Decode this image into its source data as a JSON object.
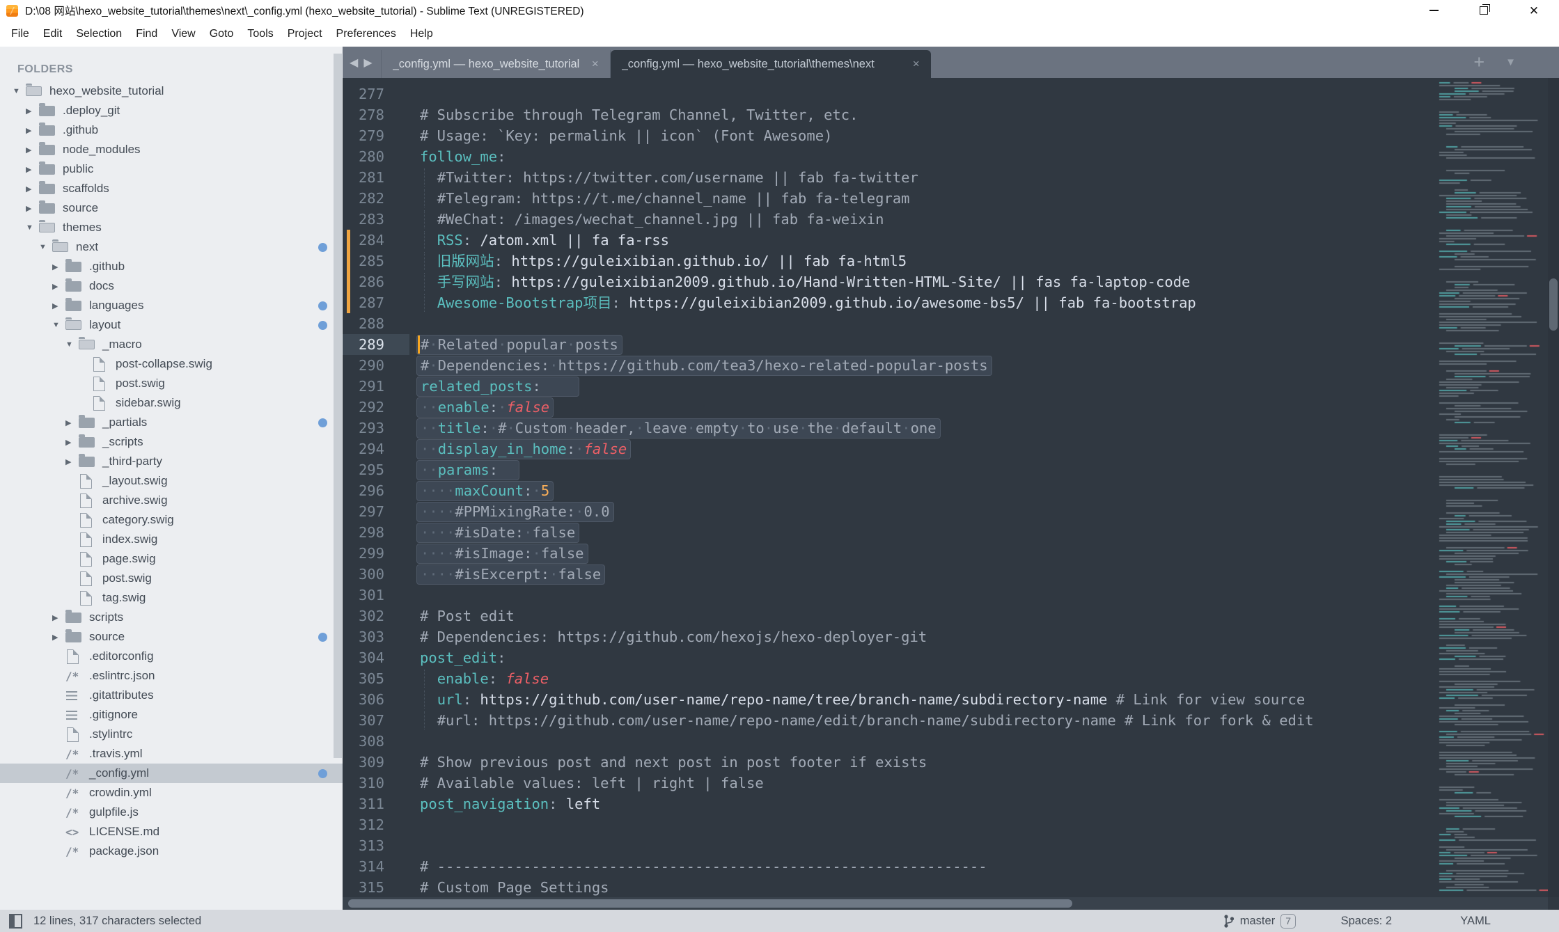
{
  "window": {
    "title": "D:\\08 网站\\hexo_website_tutorial\\themes\\next\\_config.yml (hexo_website_tutorial) - Sublime Text (UNREGISTERED)"
  },
  "menu": [
    "File",
    "Edit",
    "Selection",
    "Find",
    "View",
    "Goto",
    "Tools",
    "Project",
    "Preferences",
    "Help"
  ],
  "sidebar": {
    "header": "FOLDERS",
    "items": [
      {
        "label": "hexo_website_tutorial",
        "icon": "folder-open",
        "arrow": "down",
        "level": 0
      },
      {
        "label": ".deploy_git",
        "icon": "folder",
        "arrow": "right",
        "level": 1
      },
      {
        "label": ".github",
        "icon": "folder",
        "arrow": "right",
        "level": 1
      },
      {
        "label": "node_modules",
        "icon": "folder",
        "arrow": "right",
        "level": 1
      },
      {
        "label": "public",
        "icon": "folder",
        "arrow": "right",
        "level": 1
      },
      {
        "label": "scaffolds",
        "icon": "folder",
        "arrow": "right",
        "level": 1
      },
      {
        "label": "source",
        "icon": "folder",
        "arrow": "right",
        "level": 1
      },
      {
        "label": "themes",
        "icon": "folder-open",
        "arrow": "down",
        "level": 1
      },
      {
        "label": "next",
        "icon": "folder-open",
        "arrow": "down",
        "level": 2,
        "dot": true
      },
      {
        "label": ".github",
        "icon": "folder",
        "arrow": "right",
        "level": 3
      },
      {
        "label": "docs",
        "icon": "folder",
        "arrow": "right",
        "level": 3
      },
      {
        "label": "languages",
        "icon": "folder",
        "arrow": "right",
        "level": 3,
        "dot": true
      },
      {
        "label": "layout",
        "icon": "folder-open",
        "arrow": "down",
        "level": 3,
        "dot": true
      },
      {
        "label": "_macro",
        "icon": "folder-open",
        "arrow": "down",
        "level": 4
      },
      {
        "label": "post-collapse.swig",
        "icon": "file",
        "level": 5
      },
      {
        "label": "post.swig",
        "icon": "file",
        "level": 5
      },
      {
        "label": "sidebar.swig",
        "icon": "file",
        "level": 5
      },
      {
        "label": "_partials",
        "icon": "folder",
        "arrow": "right",
        "level": 4,
        "dot": true
      },
      {
        "label": "_scripts",
        "icon": "folder",
        "arrow": "right",
        "level": 4
      },
      {
        "label": "_third-party",
        "icon": "folder",
        "arrow": "right",
        "level": 4
      },
      {
        "label": "_layout.swig",
        "icon": "file",
        "level": 4
      },
      {
        "label": "archive.swig",
        "icon": "file",
        "level": 4
      },
      {
        "label": "category.swig",
        "icon": "file",
        "level": 4
      },
      {
        "label": "index.swig",
        "icon": "file",
        "level": 4
      },
      {
        "label": "page.swig",
        "icon": "file",
        "level": 4
      },
      {
        "label": "post.swig",
        "icon": "file",
        "level": 4
      },
      {
        "label": "tag.swig",
        "icon": "file",
        "level": 4
      },
      {
        "label": "scripts",
        "icon": "folder",
        "arrow": "right",
        "level": 3
      },
      {
        "label": "source",
        "icon": "folder",
        "arrow": "right",
        "level": 3,
        "dot": true
      },
      {
        "label": ".editorconfig",
        "icon": "file",
        "level": 3
      },
      {
        "label": ".eslintrc.json",
        "icon": "slash-star",
        "level": 3
      },
      {
        "label": ".gitattributes",
        "icon": "list",
        "level": 3
      },
      {
        "label": ".gitignore",
        "icon": "list",
        "level": 3
      },
      {
        "label": ".stylintrc",
        "icon": "file",
        "level": 3
      },
      {
        "label": ".travis.yml",
        "icon": "slash-star",
        "level": 3
      },
      {
        "label": "_config.yml",
        "icon": "slash-star",
        "level": 3,
        "dot": true,
        "selected": true
      },
      {
        "label": "crowdin.yml",
        "icon": "slash-star",
        "level": 3
      },
      {
        "label": "gulpfile.js",
        "icon": "slash-star",
        "level": 3
      },
      {
        "label": "LICENSE.md",
        "icon": "angle",
        "level": 3
      },
      {
        "label": "package.json",
        "icon": "slash-star",
        "level": 3
      }
    ]
  },
  "tabs": {
    "back_icon": "◀",
    "forward_icon": "▶",
    "items": [
      {
        "title": "_config.yml — hexo_website_tutorial",
        "active": false,
        "close": "×"
      },
      {
        "title": "_config.yml — hexo_website_tutorial\\themes\\next",
        "active": true,
        "close": "×"
      }
    ],
    "new_tab_icon": "+",
    "tab_list_icon": "▼"
  },
  "editor": {
    "lines": [
      {
        "n": 277,
        "tk": []
      },
      {
        "n": 278,
        "tk": [
          {
            "c": "com",
            "t": "# Subscribe through Telegram Channel, Twitter, etc."
          }
        ]
      },
      {
        "n": 279,
        "tk": [
          {
            "c": "com",
            "t": "# Usage: `Key: permalink || icon` (Font Awesome)"
          }
        ]
      },
      {
        "n": 280,
        "tk": [
          {
            "c": "key",
            "t": "follow_me"
          },
          {
            "c": "pun",
            "t": ":"
          }
        ]
      },
      {
        "n": 281,
        "guide": true,
        "tk": [
          {
            "c": "ws",
            "t": "  "
          },
          {
            "c": "com",
            "t": "#Twitter: https://twitter.com/username || fab fa-twitter"
          }
        ]
      },
      {
        "n": 282,
        "guide": true,
        "tk": [
          {
            "c": "ws",
            "t": "  "
          },
          {
            "c": "com",
            "t": "#Telegram: https://t.me/channel_name || fab fa-telegram"
          }
        ]
      },
      {
        "n": 283,
        "guide": true,
        "tk": [
          {
            "c": "ws",
            "t": "  "
          },
          {
            "c": "com",
            "t": "#WeChat: /images/wechat_channel.jpg || fab fa-weixin"
          }
        ]
      },
      {
        "n": 284,
        "guide": true,
        "mod": true,
        "tk": [
          {
            "c": "ws",
            "t": "  "
          },
          {
            "c": "key",
            "t": "RSS"
          },
          {
            "c": "pun",
            "t": ":"
          },
          {
            "c": "val",
            "t": " /atom.xml || fa fa-rss"
          }
        ]
      },
      {
        "n": 285,
        "guide": true,
        "mod": true,
        "tk": [
          {
            "c": "ws",
            "t": "  "
          },
          {
            "c": "key",
            "t": "旧版网站"
          },
          {
            "c": "pun",
            "t": ":"
          },
          {
            "c": "val",
            "t": " https://guleixibian.github.io/ || fab fa-html5"
          }
        ]
      },
      {
        "n": 286,
        "guide": true,
        "mod": true,
        "tk": [
          {
            "c": "ws",
            "t": "  "
          },
          {
            "c": "key",
            "t": "手写网站"
          },
          {
            "c": "pun",
            "t": ":"
          },
          {
            "c": "val",
            "t": " https://guleixibian2009.github.io/Hand-Written-HTML-Site/ || fas fa-laptop-code"
          }
        ]
      },
      {
        "n": 287,
        "guide": true,
        "mod": true,
        "tk": [
          {
            "c": "ws",
            "t": "  "
          },
          {
            "c": "key",
            "t": "Awesome-Bootstrap项目"
          },
          {
            "c": "pun",
            "t": ":"
          },
          {
            "c": "val",
            "t": " https://guleixibian2009.github.io/awesome-bs5/ || fab fa-bootstrap"
          }
        ]
      },
      {
        "n": 288,
        "tk": []
      },
      {
        "n": 289,
        "sel": true,
        "cur": true,
        "tk": [
          {
            "c": "com",
            "t": "# Related popular posts"
          }
        ]
      },
      {
        "n": 290,
        "sel": true,
        "tk": [
          {
            "c": "com",
            "t": "# Dependencies: https://github.com/tea3/hexo-related-popular-posts"
          }
        ]
      },
      {
        "n": 291,
        "sel": true,
        "tk": [
          {
            "c": "key",
            "t": "related_posts"
          },
          {
            "c": "pun",
            "t": ":"
          },
          {
            "c": "nl",
            "t": "    "
          }
        ]
      },
      {
        "n": 292,
        "sel": true,
        "tk": [
          {
            "c": "ws",
            "t": "  "
          },
          {
            "c": "key",
            "t": "enable"
          },
          {
            "c": "pun",
            "t": ":"
          },
          {
            "c": "ws",
            "t": " "
          },
          {
            "c": "fls",
            "t": "false"
          }
        ]
      },
      {
        "n": 293,
        "sel": true,
        "tk": [
          {
            "c": "ws",
            "t": "  "
          },
          {
            "c": "key",
            "t": "title"
          },
          {
            "c": "pun",
            "t": ":"
          },
          {
            "c": "ws",
            "t": " "
          },
          {
            "c": "com",
            "t": "# Custom header, leave empty to use the default one"
          }
        ]
      },
      {
        "n": 294,
        "sel": true,
        "tk": [
          {
            "c": "ws",
            "t": "  "
          },
          {
            "c": "key",
            "t": "display_in_home"
          },
          {
            "c": "pun",
            "t": ":"
          },
          {
            "c": "ws",
            "t": " "
          },
          {
            "c": "fls",
            "t": "false"
          }
        ]
      },
      {
        "n": 295,
        "sel": true,
        "tk": [
          {
            "c": "ws",
            "t": "  "
          },
          {
            "c": "key",
            "t": "params"
          },
          {
            "c": "pun",
            "t": ":"
          },
          {
            "c": "nl",
            "t": "  "
          }
        ]
      },
      {
        "n": 296,
        "sel": true,
        "tk": [
          {
            "c": "ws",
            "t": "    "
          },
          {
            "c": "key",
            "t": "maxCount"
          },
          {
            "c": "pun",
            "t": ":"
          },
          {
            "c": "ws",
            "t": " "
          },
          {
            "c": "num",
            "t": "5"
          }
        ]
      },
      {
        "n": 297,
        "sel": true,
        "tk": [
          {
            "c": "ws",
            "t": "    "
          },
          {
            "c": "com",
            "t": "#PPMixingRate: 0.0"
          }
        ]
      },
      {
        "n": 298,
        "sel": true,
        "tk": [
          {
            "c": "ws",
            "t": "    "
          },
          {
            "c": "com",
            "t": "#isDate: false"
          }
        ]
      },
      {
        "n": 299,
        "sel": true,
        "tk": [
          {
            "c": "ws",
            "t": "    "
          },
          {
            "c": "com",
            "t": "#isImage: false"
          }
        ]
      },
      {
        "n": 300,
        "sel": true,
        "tk": [
          {
            "c": "ws",
            "t": "    "
          },
          {
            "c": "com",
            "t": "#isExcerpt: false"
          }
        ]
      },
      {
        "n": 301,
        "tk": []
      },
      {
        "n": 302,
        "tk": [
          {
            "c": "com",
            "t": "# Post edit"
          }
        ]
      },
      {
        "n": 303,
        "tk": [
          {
            "c": "com",
            "t": "# Dependencies: https://github.com/hexojs/hexo-deployer-git"
          }
        ]
      },
      {
        "n": 304,
        "tk": [
          {
            "c": "key",
            "t": "post_edit"
          },
          {
            "c": "pun",
            "t": ":"
          }
        ]
      },
      {
        "n": 305,
        "guide": true,
        "tk": [
          {
            "c": "ws",
            "t": "  "
          },
          {
            "c": "key",
            "t": "enable"
          },
          {
            "c": "pun",
            "t": ":"
          },
          {
            "c": "ws",
            "t": " "
          },
          {
            "c": "fls",
            "t": "false"
          }
        ]
      },
      {
        "n": 306,
        "guide": true,
        "tk": [
          {
            "c": "ws",
            "t": "  "
          },
          {
            "c": "key",
            "t": "url"
          },
          {
            "c": "pun",
            "t": ":"
          },
          {
            "c": "val",
            "t": " https://github.com/user-name/repo-name/tree/branch-name/subdirectory-name "
          },
          {
            "c": "com",
            "t": "# Link for view source"
          }
        ]
      },
      {
        "n": 307,
        "guide": true,
        "tk": [
          {
            "c": "ws",
            "t": "  "
          },
          {
            "c": "com",
            "t": "#url: https://github.com/user-name/repo-name/edit/branch-name/subdirectory-name # Link for fork & edit"
          }
        ]
      },
      {
        "n": 308,
        "tk": []
      },
      {
        "n": 309,
        "tk": [
          {
            "c": "com",
            "t": "# Show previous post and next post in post footer if exists"
          }
        ]
      },
      {
        "n": 310,
        "tk": [
          {
            "c": "com",
            "t": "# Available values: left | right | false"
          }
        ]
      },
      {
        "n": 311,
        "tk": [
          {
            "c": "key",
            "t": "post_navigation"
          },
          {
            "c": "pun",
            "t": ":"
          },
          {
            "c": "val",
            "t": " left"
          }
        ]
      },
      {
        "n": 312,
        "tk": []
      },
      {
        "n": 313,
        "tk": []
      },
      {
        "n": 314,
        "tk": [
          {
            "c": "com",
            "t": "# ----------------------------------------------------------------"
          }
        ]
      },
      {
        "n": 315,
        "tk": [
          {
            "c": "com",
            "t": "# Custom Page Settings"
          }
        ]
      }
    ]
  },
  "status": {
    "selection_info": "12 lines, 317 characters selected",
    "branch": "master",
    "branch_badge": "7",
    "indent": "Spaces: 2",
    "syntax": "YAML"
  },
  "colors": {
    "editor_bg": "#303841",
    "key_teal": "#5bbfbf",
    "false_red": "#ec5f66",
    "number_orange": "#f9ae58",
    "modified_marker": "#f0a541",
    "sidebar_dot_blue": "#6f9fd8"
  }
}
